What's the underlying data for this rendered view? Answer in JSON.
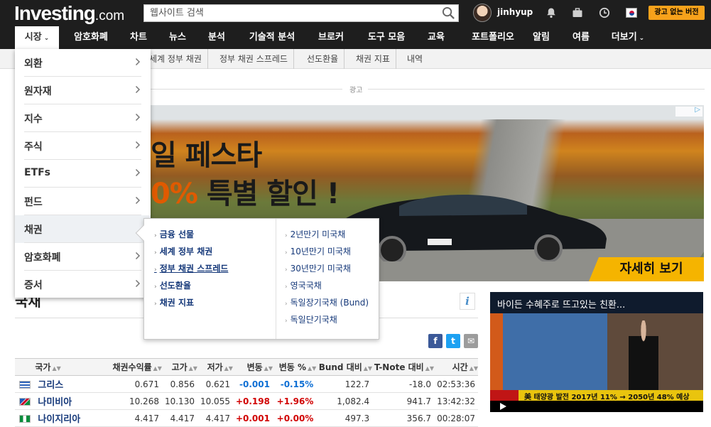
{
  "header": {
    "logo_main": "Investing",
    "logo_suffix": ".com",
    "search_placeholder": "웹사이트 검색",
    "username": "jinhyup",
    "adfree_label": "광고 없는 버전"
  },
  "nav": {
    "items": [
      {
        "label": "시장"
      },
      {
        "label": "암호화폐"
      },
      {
        "label": "차트"
      },
      {
        "label": "뉴스"
      },
      {
        "label": "분석"
      },
      {
        "label": "기술적 분석"
      },
      {
        "label": "브로커"
      },
      {
        "label": "도구 모음"
      },
      {
        "label": "교육"
      },
      {
        "label": "포트폴리오"
      },
      {
        "label": "알림"
      },
      {
        "label": "여름"
      },
      {
        "label": "더보기"
      }
    ],
    "chevron": "⌄"
  },
  "subnav": {
    "items": [
      "세계 정부 채권",
      "정부 채권 스프레드",
      "선도환율",
      "채권 지표",
      "내역"
    ]
  },
  "ad": {
    "label": "광고",
    "headline1": "일 페스타",
    "headline2_pct": "0%",
    "headline2_rest": " 특별 할인 !",
    "cta": "자세히 보기"
  },
  "market_menu": {
    "items": [
      "외환",
      "원자재",
      "지수",
      "주식",
      "ETFs",
      "펀드",
      "채권",
      "암호화폐",
      "증서"
    ]
  },
  "flyout": {
    "left": [
      "금융 선물",
      "세계 정부 채권",
      "정부 채권 스프레드",
      "선도환율",
      "채권 지표"
    ],
    "right": [
      "2년만기 미국채",
      "10년만기 미국채",
      "30년만기 미국채",
      "영국국채",
      "독일장기국채 (Bund)",
      "독일단기국채"
    ]
  },
  "page": {
    "title": "국채",
    "info": "i"
  },
  "share": {
    "facebook": "f",
    "twitter": "t",
    "email": "✉"
  },
  "table": {
    "headers": [
      "국가",
      "채권수익률",
      "고가",
      "저가",
      "변동",
      "변동 %",
      "Bund 대비",
      "T-Note 대비",
      "시간"
    ],
    "rows": [
      {
        "country": "그리스",
        "yield": "0.671",
        "high": "0.856",
        "low": "0.621",
        "chg": "-0.001",
        "chg_pct": "-0.15%",
        "vs_bund": "122.7",
        "vs_tnote": "-18.0",
        "time": "02:53:36",
        "dir": "neg"
      },
      {
        "country": "나미비아",
        "yield": "10.268",
        "high": "10.130",
        "low": "10.055",
        "chg": "+0.198",
        "chg_pct": "+1.96%",
        "vs_bund": "1,082.4",
        "vs_tnote": "941.7",
        "time": "13:42:32",
        "dir": "pos"
      },
      {
        "country": "나이지리아",
        "yield": "4.417",
        "high": "4.417",
        "low": "4.417",
        "chg": "+0.001",
        "chg_pct": "+0.00%",
        "vs_bund": "497.3",
        "vs_tnote": "356.7",
        "time": "00:28:07",
        "dir": "pos"
      }
    ]
  },
  "video": {
    "title": "바이든 수혜주로 뜨고있는 친환...",
    "ticker": "美 태양광 발전 2017년 11% → 2050년 48% 예상"
  }
}
